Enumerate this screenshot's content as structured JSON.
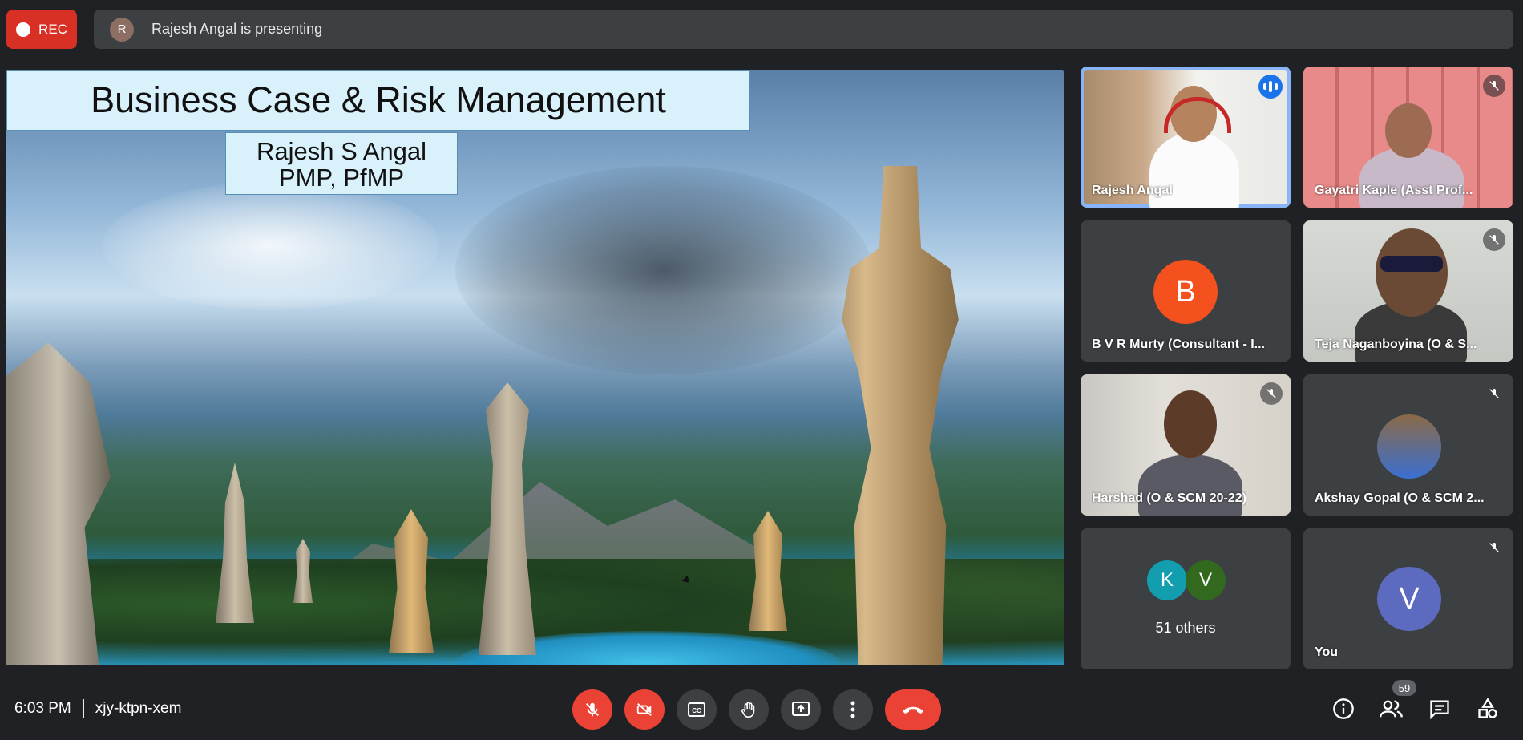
{
  "top_bar": {
    "rec_label": "REC",
    "presenter_initial": "R",
    "presenting_text": "Rajesh Angal is presenting"
  },
  "slide": {
    "title": "Business Case & Risk Management",
    "author_line1": "Rajesh S Angal",
    "author_line2": "PMP, PfMP"
  },
  "participants": [
    {
      "name": "Rajesh Angal",
      "speaking": true
    },
    {
      "name": "Gayatri Kaple (Asst Prof..."
    },
    {
      "name": "B V R Murty (Consultant - I...",
      "initial": "B",
      "color": "#f4511e"
    },
    {
      "name": "Teja Naganboyina (O & S..."
    },
    {
      "name": "Harshad (O & SCM 20-22)"
    },
    {
      "name": "Akshay Gopal (O & SCM 2..."
    },
    {
      "others_label": "51 others",
      "initials": [
        "K",
        "V"
      ],
      "colors": [
        "#129eaf",
        "#33691e"
      ]
    },
    {
      "name": "You",
      "initial": "V",
      "color": "#5c6bc0"
    }
  ],
  "bottom_bar": {
    "time": "6:03 PM",
    "meeting_code": "xjy-ktpn-xem",
    "participants_count": "59"
  },
  "icons": [
    "record-icon",
    "mic-off-icon",
    "camera-off-icon",
    "captions-icon",
    "raise-hand-icon",
    "present-icon",
    "more-icon",
    "hang-up-icon",
    "info-icon",
    "people-icon",
    "chat-icon",
    "activities-icon"
  ]
}
